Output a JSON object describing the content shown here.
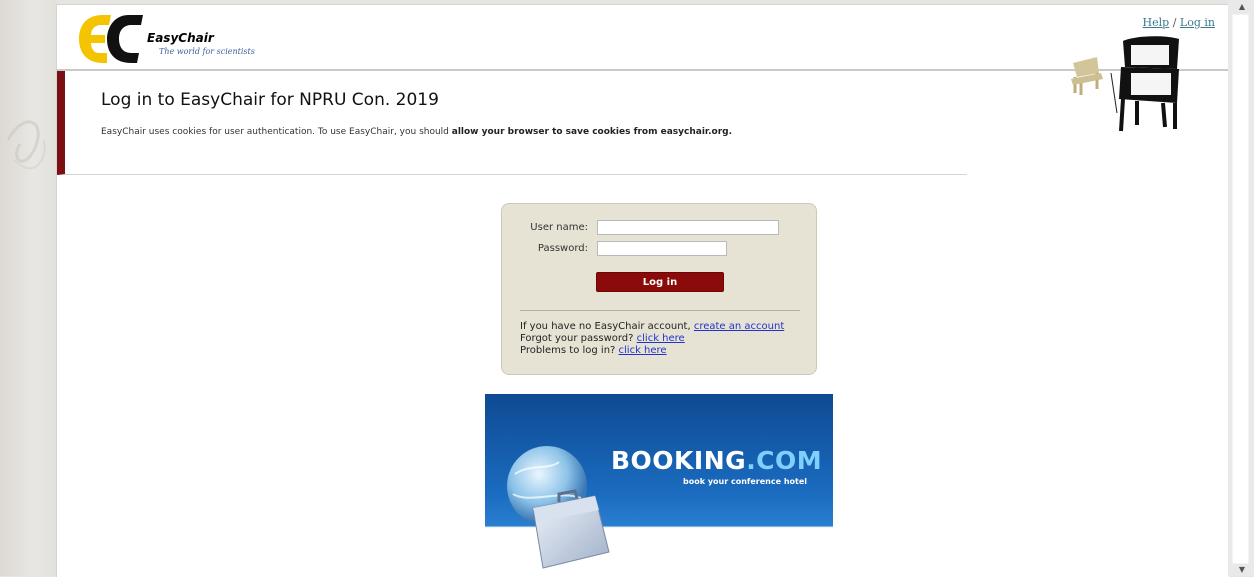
{
  "header": {
    "brand_name": "EasyChair",
    "brand_tagline": "The world for scientists",
    "help_link": "Help",
    "separator": "/",
    "login_link": "Log in"
  },
  "title_block": {
    "title": "Log in to EasyChair for NPRU Con. 2019",
    "cookie_prefix": "EasyChair uses cookies for user authentication. To use EasyChair, you should ",
    "cookie_bold": "allow your browser to save cookies from easychair.org."
  },
  "login_form": {
    "username_label": "User name:",
    "username_value": "",
    "password_label": "Password:",
    "password_value": "",
    "submit_label": "Log in",
    "no_account_text": "If you have no EasyChair account, ",
    "create_account_link": "create an account",
    "forgot_text": "Forgot your password? ",
    "forgot_link": "click here",
    "problems_text": "Problems to log in? ",
    "problems_link": "click here"
  },
  "banner": {
    "brand_main": "BOOKING",
    "brand_suffix": ".COM",
    "tagline": "book your conference hotel"
  },
  "colors": {
    "accent_red": "#8b0a0a",
    "link_blue": "#2233cc",
    "logo_yellow": "#f5c400",
    "booking_blue": "#1b6cc0"
  },
  "icons": [
    "easychair-logo-icon",
    "chairs-illustration-icon",
    "globe-suitcase-icon"
  ]
}
